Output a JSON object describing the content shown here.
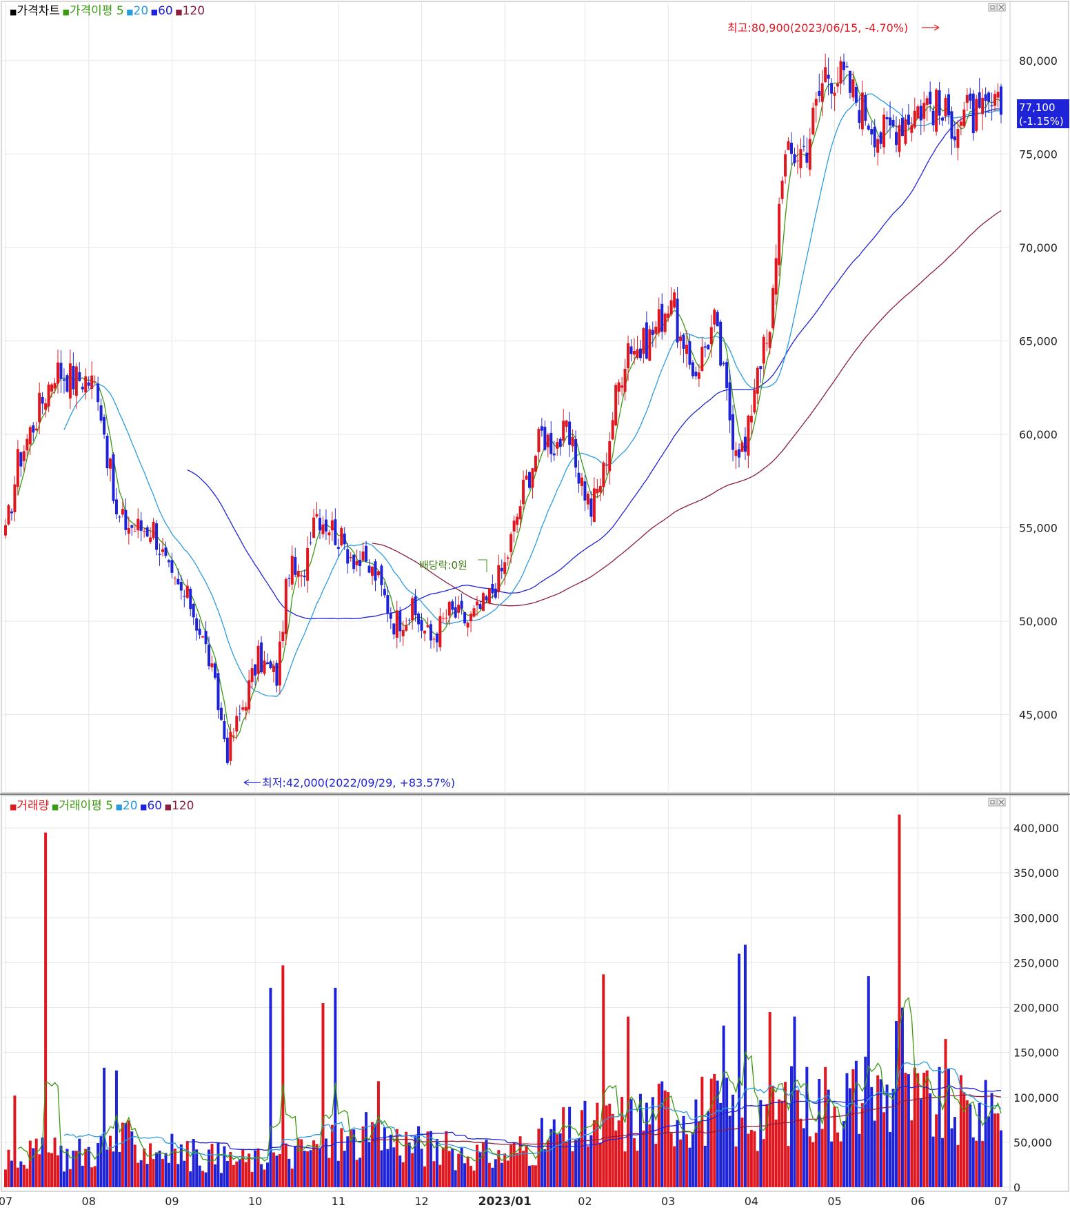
{
  "price_panel": {
    "legend": [
      {
        "marker": "■",
        "label": "가격차트",
        "color": "#000000"
      },
      {
        "marker": "■",
        "label": "가격이평",
        "color": "#3a9a12"
      },
      {
        "marker": "",
        "label": "5",
        "color": "#3a9a12"
      },
      {
        "marker": "■",
        "label": "20",
        "color": "#2b9be0"
      },
      {
        "marker": "■",
        "label": "60",
        "color": "#1f23d8"
      },
      {
        "marker": "■",
        "label": "120",
        "color": "#8a1e3c"
      }
    ],
    "max_annotation": "최고:80,900(2023/06/15, -4.70%)",
    "min_annotation": "최저:42,000(2022/09/29, +83.57%)",
    "dividend_note": "배당락:0원",
    "current_price": "77,100",
    "current_change": "(-1.15%)"
  },
  "volume_panel": {
    "legend": [
      {
        "marker": "■",
        "label": "거래량",
        "color": "#e1171f"
      },
      {
        "marker": "■",
        "label": "거래이평",
        "color": "#3a9a12"
      },
      {
        "marker": "",
        "label": "5",
        "color": "#3a9a12"
      },
      {
        "marker": "■",
        "label": "20",
        "color": "#2b9be0"
      },
      {
        "marker": "■",
        "label": "60",
        "color": "#1f23d8"
      },
      {
        "marker": "■",
        "label": "120",
        "color": "#8a1e3c"
      }
    ]
  },
  "x_axis_labels": [
    {
      "label": "07",
      "emphasis": false
    },
    {
      "label": "08",
      "emphasis": false
    },
    {
      "label": "09",
      "emphasis": false
    },
    {
      "label": "10",
      "emphasis": false
    },
    {
      "label": "11",
      "emphasis": false
    },
    {
      "label": "12",
      "emphasis": false
    },
    {
      "label": "2023/01",
      "emphasis": true
    },
    {
      "label": "02",
      "emphasis": false
    },
    {
      "label": "03",
      "emphasis": false
    },
    {
      "label": "04",
      "emphasis": false
    },
    {
      "label": "05",
      "emphasis": false
    },
    {
      "label": "06",
      "emphasis": false
    },
    {
      "label": "07",
      "emphasis": false
    }
  ],
  "colors": {
    "up": "#e1171f",
    "down": "#1f23d8",
    "ma5": "#3a9a12",
    "ma20": "#2b9be0",
    "ma60": "#1f23d8",
    "ma120": "#8a1e3c",
    "grid": "#e6e6e6",
    "current_bg": "#1f23d8"
  },
  "chart_data": [
    {
      "type": "candlestick",
      "title": "가격차트",
      "x_range": [
        "2022-07",
        "2023-07"
      ],
      "ylim": [
        41000,
        82500
      ],
      "y_ticks": [
        45000,
        50000,
        55000,
        60000,
        65000,
        70000,
        75000,
        80000
      ],
      "y_tick_labels": [
        "45,000",
        "50,000",
        "55,000",
        "60,000",
        "65,000",
        "70,000",
        "75,000",
        "80,000"
      ],
      "grid": true,
      "price_waypoints": {
        "x": [
          0,
          4,
          10,
          16,
          22,
          26,
          30,
          36,
          42,
          48,
          54,
          60,
          66,
          72,
          76,
          82,
          88,
          92,
          96,
          100,
          106,
          110,
          116,
          120,
          126,
          132,
          138,
          144,
          150,
          156,
          162,
          168,
          174,
          178,
          182,
          186,
          190,
          194,
          198,
          202,
          206,
          212,
          216,
          220,
          224,
          230,
          236,
          240,
          244,
          248,
          250,
          252,
          256,
          260,
          266,
          272,
          276,
          280,
          284,
          288,
          292,
          296,
          300,
          304,
          308,
          312,
          316,
          320,
          323
        ],
        "close": [
          54500,
          58500,
          61000,
          63500,
          63000,
          63000,
          62500,
          55500,
          55000,
          55000,
          52000,
          51000,
          48000,
          43000,
          45000,
          48000,
          47000,
          53000,
          52000,
          56000,
          55000,
          54000,
          53000,
          52500,
          50000,
          50500,
          49000,
          50500,
          50000,
          51000,
          53000,
          57000,
          60000,
          59500,
          60000,
          58000,
          56000,
          58000,
          62000,
          65000,
          64500,
          66000,
          67500,
          64000,
          63500,
          66000,
          60000,
          59000,
          64000,
          65000,
          70000,
          74500,
          75000,
          75500,
          79500,
          79000,
          78000,
          77000,
          76000,
          76500,
          77000,
          77500,
          77800,
          77000,
          76800,
          77200,
          76800,
          77500,
          77100
        ]
      },
      "series": [
        {
          "name": "5",
          "role": "moving_average"
        },
        {
          "name": "20",
          "role": "moving_average"
        },
        {
          "name": "60",
          "role": "moving_average"
        },
        {
          "name": "120",
          "role": "moving_average"
        }
      ],
      "annotations": [
        {
          "text": "최고:80,900(2023/06/15, -4.70%)",
          "x": "2023-06-15",
          "y": 80900
        },
        {
          "text": "최저:42,000(2022/09/29, +83.57%)",
          "x": "2022-09-29",
          "y": 42000
        }
      ]
    },
    {
      "type": "bar",
      "title": "거래량",
      "ylim": [
        0,
        420000
      ],
      "y_ticks": [
        0,
        50000,
        100000,
        150000,
        200000,
        250000,
        300000,
        350000,
        400000
      ],
      "y_tick_labels": [
        "0",
        "50,000",
        "100,000",
        "150,000",
        "200,000",
        "250,000",
        "300,000",
        "350,000",
        "400,000"
      ],
      "grid": true,
      "volume_waypoints": {
        "x": [
          0,
          20,
          40,
          60,
          80,
          100,
          120,
          140,
          160,
          180,
          200,
          220,
          240,
          260,
          280,
          300,
          323
        ],
        "volume": [
          40000,
          38000,
          52000,
          38000,
          30000,
          45000,
          60000,
          45000,
          35000,
          62000,
          75000,
          95000,
          85000,
          100000,
          110000,
          95000,
          80000
        ]
      },
      "spikes": [
        {
          "x": 3,
          "volume": 102000
        },
        {
          "x": 13,
          "volume": 395000
        },
        {
          "x": 32,
          "volume": 133000
        },
        {
          "x": 36,
          "volume": 130000
        },
        {
          "x": 86,
          "volume": 222000
        },
        {
          "x": 90,
          "volume": 247000
        },
        {
          "x": 103,
          "volume": 205000
        },
        {
          "x": 107,
          "volume": 222000
        },
        {
          "x": 121,
          "volume": 118000
        },
        {
          "x": 194,
          "volume": 237000
        },
        {
          "x": 202,
          "volume": 190000
        },
        {
          "x": 233,
          "volume": 180000
        },
        {
          "x": 238,
          "volume": 260000
        },
        {
          "x": 240,
          "volume": 270000
        },
        {
          "x": 248,
          "volume": 195000
        },
        {
          "x": 256,
          "volume": 190000
        },
        {
          "x": 280,
          "volume": 235000
        },
        {
          "x": 289,
          "volume": 185000
        },
        {
          "x": 290,
          "volume": 415000
        },
        {
          "x": 291,
          "volume": 200000
        },
        {
          "x": 305,
          "volume": 165000
        },
        {
          "x": 320,
          "volume": 105000
        }
      ]
    }
  ]
}
